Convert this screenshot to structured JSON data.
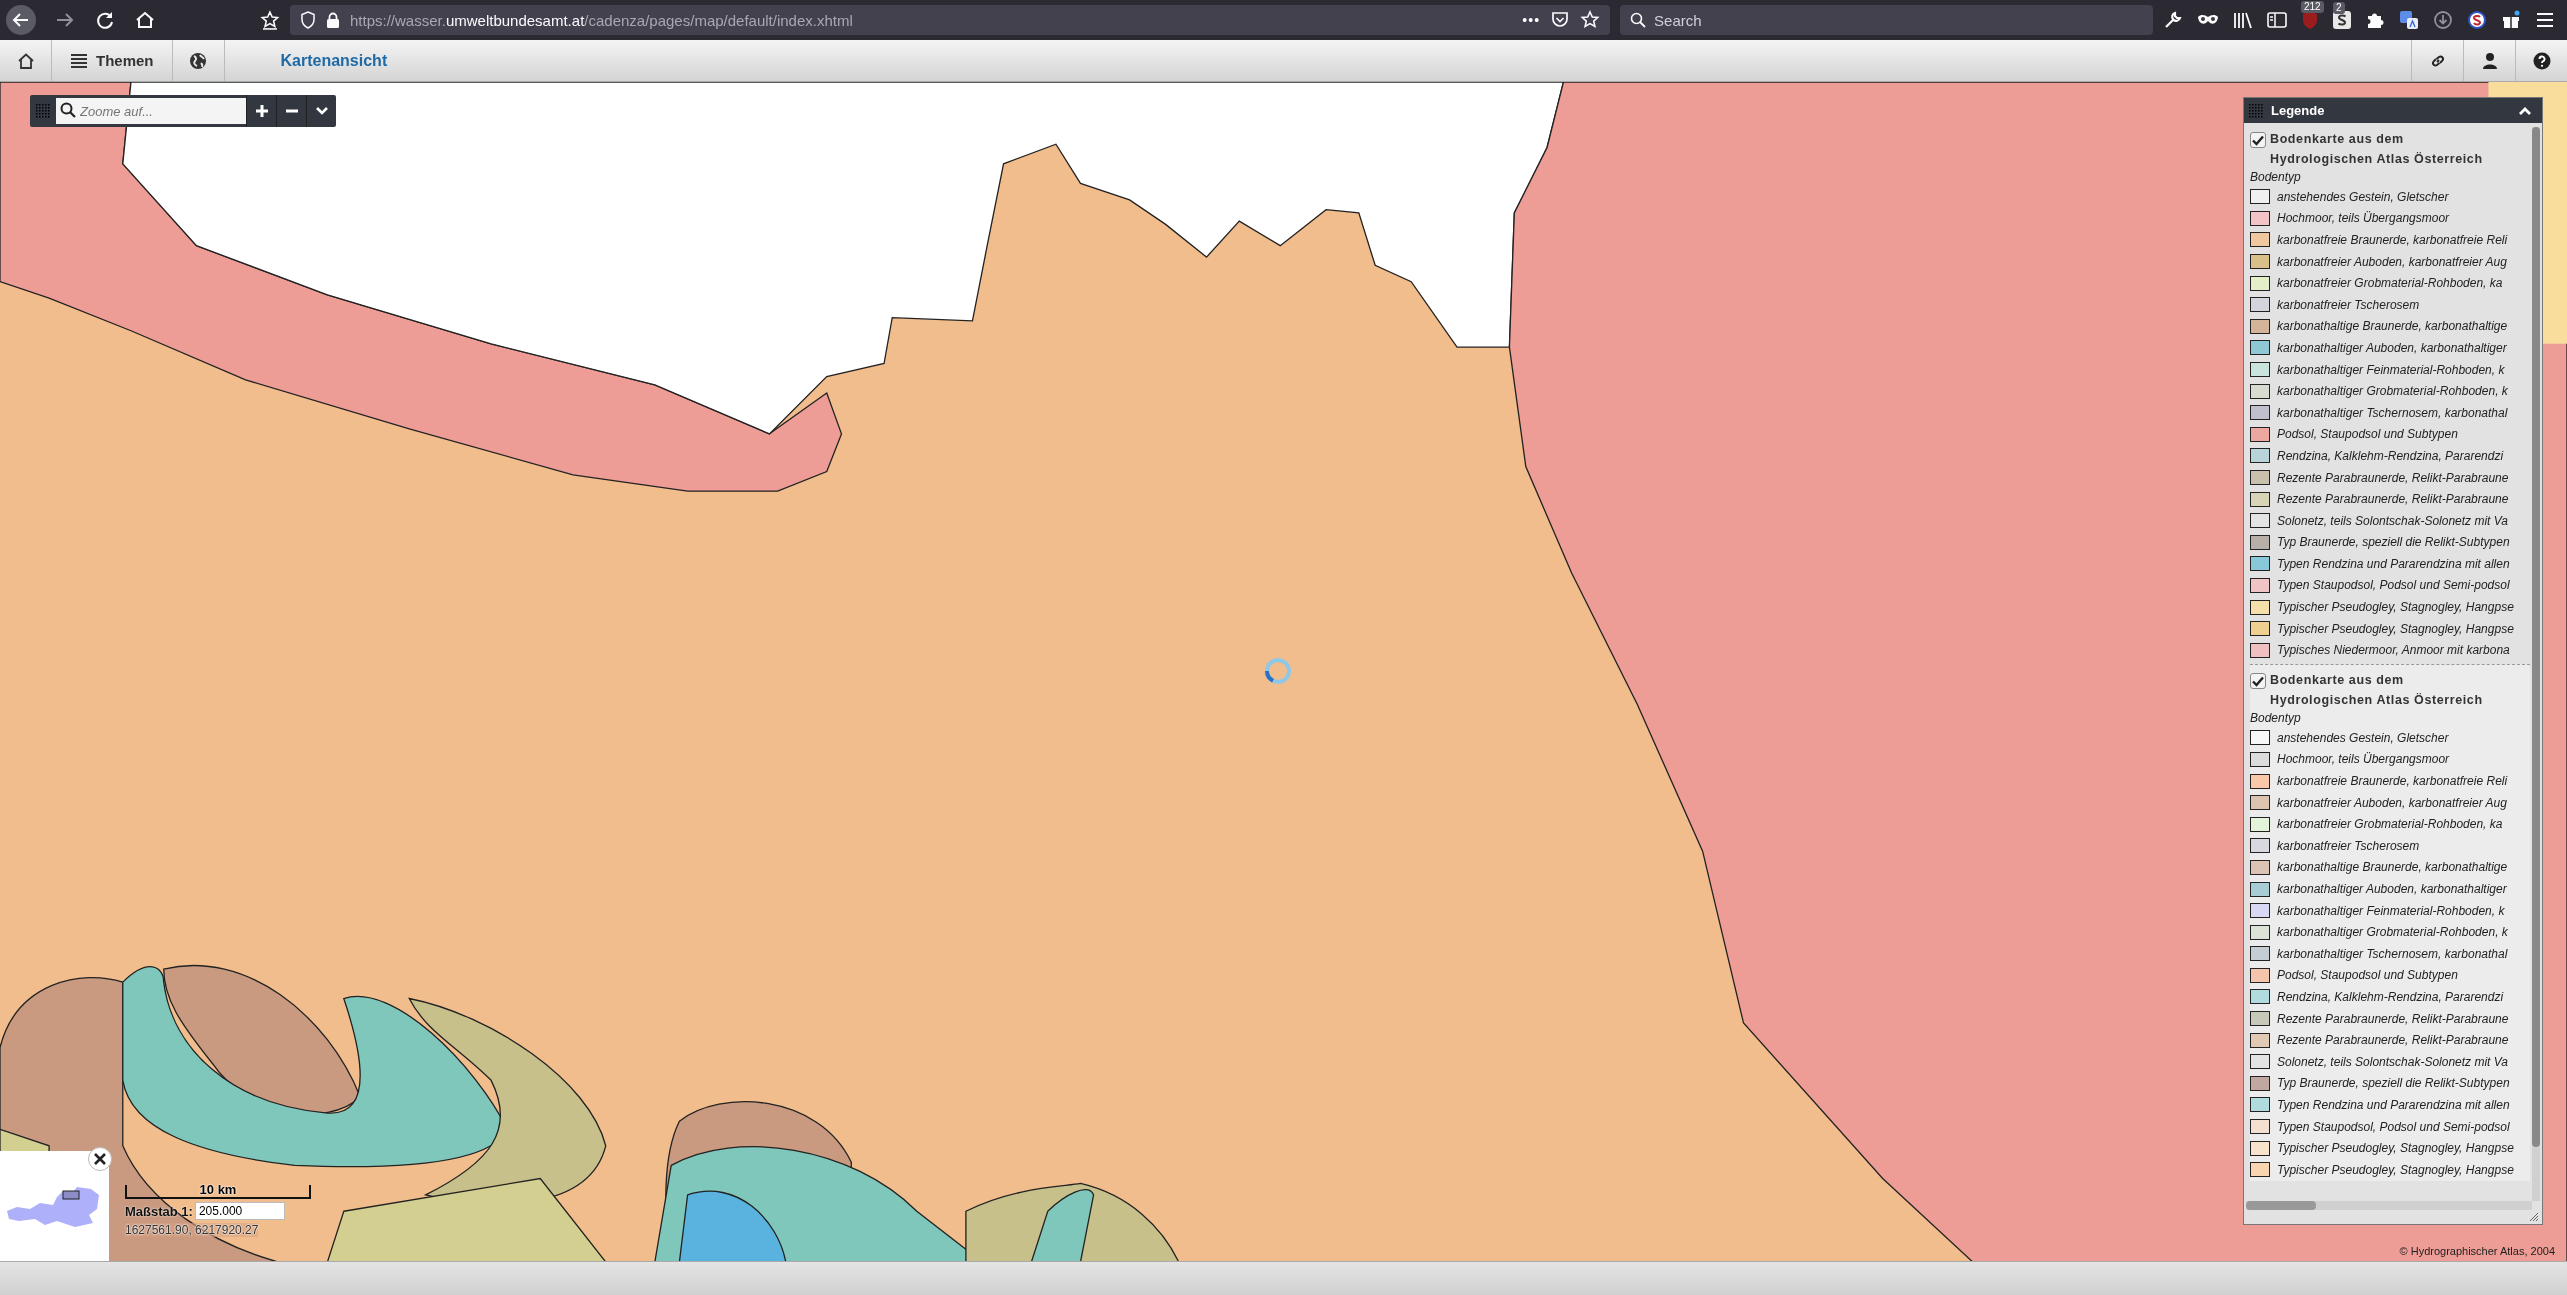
{
  "browser": {
    "url": {
      "prefix": "https://wasser.",
      "host": "umweltbundesamt.at",
      "path": "/cadenza/pages/map/default/index.xhtml"
    },
    "page_actions": "•••",
    "search": {
      "placeholder": "Search"
    },
    "extensions": [
      {
        "kind": "wrench"
      },
      {
        "kind": "mask"
      },
      {
        "kind": "library"
      },
      {
        "kind": "sidebar"
      },
      {
        "kind": "shield-badge",
        "badge": "212"
      },
      {
        "kind": "s-badge",
        "badge": "2"
      },
      {
        "kind": "puzzle"
      },
      {
        "kind": "translate"
      },
      {
        "kind": "download"
      },
      {
        "kind": "s-circle"
      },
      {
        "kind": "gift"
      },
      {
        "kind": "menu"
      }
    ]
  },
  "toolbar": {
    "themes_button": "Themen",
    "title": "Kartenansicht"
  },
  "map_tools": {
    "search": {
      "placeholder": "Zoome auf..."
    }
  },
  "legend": {
    "title": "Legende",
    "expanded": true,
    "groups": [
      {
        "checked": true,
        "title_lines": [
          "Bodenkarte aus dem",
          "Hydrologischen Atlas Österreich"
        ],
        "subtitle": "Bodentyp",
        "items": [
          {
            "label": "anstehendes Gestein, Gletscher",
            "color": "#f0f0f0"
          },
          {
            "label": "Hochmoor, teils Übergangsmoor",
            "color": "#f2c4c8"
          },
          {
            "label": "karbonatfreie Braunerde, karbonatfreie Reli",
            "color": "#f0c8a0"
          },
          {
            "label": "karbonatfreier Auboden, karbonatfreier Aug",
            "color": "#d8c088"
          },
          {
            "label": "karbonatfreier Grobmaterial-Rohboden, ka",
            "color": "#e4eec8"
          },
          {
            "label": "karbonatfreier Tscherosem",
            "color": "#d4d4dc"
          },
          {
            "label": "karbonathaltige Braunerde, karbonathaltige",
            "color": "#d4b498"
          },
          {
            "label": "karbonathaltiger Auboden, karbonathaltiger",
            "color": "#8ec8d4"
          },
          {
            "label": "karbonathaltiger Feinmaterial-Rohboden, k",
            "color": "#c8e4dc"
          },
          {
            "label": "karbonathaltiger Grobmaterial-Rohboden, k",
            "color": "#d8dcd0"
          },
          {
            "label": "karbonathaltiger Tschernosem, karbonathal",
            "color": "#c0c0cc"
          },
          {
            "label": "Podsol, Staupodsol und Subtypen",
            "color": "#eca8a0"
          },
          {
            "label": "Rendzina, Kalklehm-Rendzina, Pararendzi",
            "color": "#b8d4d8"
          },
          {
            "label": "Rezente Parabraunerde, Relikt-Parabraune",
            "color": "#c8c0ac"
          },
          {
            "label": "Rezente Parabraunerde, Relikt-Parabraune",
            "color": "#d8d4b8"
          },
          {
            "label": "Solonetz, teils Solontschak-Solonetz mit Va",
            "color": "#e4e4e4"
          },
          {
            "label": "Typ Braunerde, speziell die Relikt-Subtypen",
            "color": "#b8b0a8"
          },
          {
            "label": "Typen Rendzina und Pararendzina mit allen",
            "color": "#88c8d8"
          },
          {
            "label": "Typen Staupodsol, Podsol und Semi-podsol",
            "color": "#f0c4c4"
          },
          {
            "label": "Typischer Pseudogley, Stagnogley, Hangpse",
            "color": "#f4e0a8"
          },
          {
            "label": "Typischer Pseudogley, Stagnogley, Hangpse",
            "color": "#f0d090"
          },
          {
            "label": "Typisches Niedermoor, Anmoor mit karbona",
            "color": "#f0c0c0"
          }
        ]
      },
      {
        "checked": true,
        "title_lines": [
          "Bodenkarte aus dem",
          "Hydrologischen Atlas Österreich"
        ],
        "subtitle": "Bodentyp",
        "items": [
          {
            "label": "anstehendes Gestein, Gletscher",
            "color": "#f8f8f8"
          },
          {
            "label": "Hochmoor, teils Übergangsmoor",
            "color": "#dcdcdc"
          },
          {
            "label": "karbonatfreie Braunerde, karbonatfreie Reli",
            "color": "#f8c8a8"
          },
          {
            "label": "karbonatfreier Auboden, karbonatfreier Aug",
            "color": "#dcc4b0"
          },
          {
            "label": "karbonatfreier Grobmaterial-Rohboden, ka",
            "color": "#e4f4d8"
          },
          {
            "label": "karbonatfreier Tscherosem",
            "color": "#d8d8e0"
          },
          {
            "label": "karbonathaltige Braunerde, karbonathaltige",
            "color": "#dcc4b4"
          },
          {
            "label": "karbonathaltiger Auboden, karbonathaltiger",
            "color": "#a8ccd4"
          },
          {
            "label": "karbonathaltiger Feinmaterial-Rohboden, k",
            "color": "#d8d8f4"
          },
          {
            "label": "karbonathaltiger Grobmaterial-Rohboden, k",
            "color": "#dce4d8"
          },
          {
            "label": "karbonathaltiger Tschernosem, karbonathal",
            "color": "#c4ccd4"
          },
          {
            "label": "Podsol, Staupodsol und Subtypen",
            "color": "#f4c4ac"
          },
          {
            "label": "Rendzina, Kalklehm-Rendzina, Pararendzi",
            "color": "#b0dce0"
          },
          {
            "label": "Rezente Parabraunerde, Relikt-Parabraune",
            "color": "#c8c8b8"
          },
          {
            "label": "Rezente Parabraunerde, Relikt-Parabraune",
            "color": "#e0cab4"
          },
          {
            "label": "Solonetz, teils Solontschak-Solonetz mit Va",
            "color": "#e4e4e4"
          },
          {
            "label": "Typ Braunerde, speziell die Relikt-Subtypen",
            "color": "#c0a8a0"
          },
          {
            "label": "Typen Rendzina und Pararendzina mit allen",
            "color": "#b0dce0"
          },
          {
            "label": "Typen Staupodsol, Podsol und Semi-podsol",
            "color": "#f4e0d0"
          },
          {
            "label": "Typischer Pseudogley, Stagnogley, Hangpse",
            "color": "#f8e4cc"
          },
          {
            "label": "Typischer Pseudogley, Stagnogley, Hangpse",
            "color": "#f8d4b0"
          }
        ]
      }
    ]
  },
  "scale": {
    "bar_label": "10 km",
    "label": "Maßstab 1:",
    "value": "205.000",
    "coordinates": "1627561.90, 6217920.27"
  },
  "attribution": "© Hydrographischer Atlas, 2004"
}
